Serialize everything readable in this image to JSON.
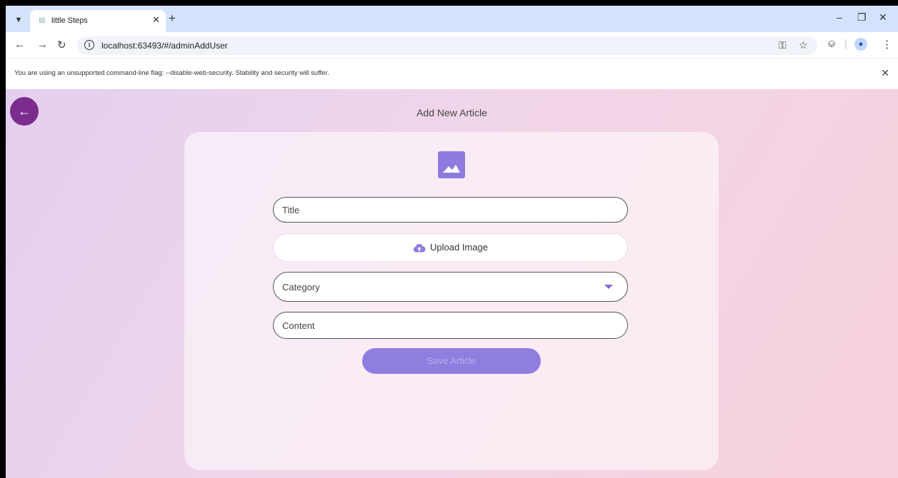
{
  "browser": {
    "tab_title": "little Steps",
    "url": "localhost:63493/#/adminAddUser",
    "infobar_text": "You are using an unsupported command-line flag: --disable-web-security. Stability and security will suffer."
  },
  "page": {
    "title": "Add New Article"
  },
  "form": {
    "title_placeholder": "Title",
    "upload_label": "Upload Image",
    "category_label": "Category",
    "content_placeholder": "Content",
    "save_label": "Save Article"
  },
  "colors": {
    "accent": "#8f7be0",
    "back_button": "#7b2d8e"
  }
}
